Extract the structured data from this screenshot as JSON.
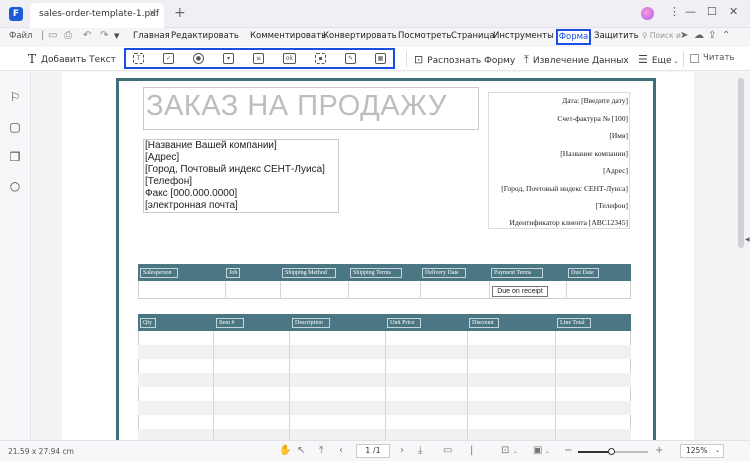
{
  "titlebar": {
    "tab_label": "sales-order-template-1.pdf",
    "close_glyph": "×",
    "new_tab_glyph": "+",
    "win_menu": "⋮",
    "win_minimize": "—",
    "win_maximize": "☐",
    "win_close": "✕"
  },
  "menubar": {
    "file": "Файл",
    "items": [
      "Главная",
      "Редактировать",
      "Комментировать",
      "Конвертировать",
      "Посмотреть",
      "Страница",
      "Инструменты"
    ],
    "active": "Форма",
    "after_active": "Защитить",
    "search_placeholder": "Поиск и"
  },
  "toolbar": {
    "add_text": "Добавить Текст",
    "recognize_form": "Распознать Форму",
    "extract_data": "Извлечение Данных",
    "more": "Еще",
    "read": "Читать",
    "form_tools": [
      "text-field",
      "checkbox",
      "radio-button",
      "combo-box",
      "list-box",
      "button",
      "image-field",
      "signature-field",
      "date-field"
    ]
  },
  "document": {
    "title": "ЗАКАЗ НА ПРОДАЖУ",
    "company_lines": [
      "[Название Вашей компании]",
      "[Адрес]",
      "[Город, Почтовый индекс СЕНТ-Луиса]",
      "[Телефон]",
      "Факс [000.000.0000]",
      "[электронная почта]"
    ],
    "info_lines": [
      "Дата: [Введите дату]",
      "Счет-фактура № [100]",
      "[Имя]",
      "[Название компании]",
      "[Адрес]",
      "[Город, Почтовый индекс СЕНТ-Луиса]",
      "[Телефон]",
      "Идентификатор клиента [ABC12345]"
    ],
    "table1_headers": [
      "Salesperson",
      "Job",
      "Shipping Method",
      "Shipping Terms",
      "Delivery Date",
      "Payment Terms",
      "Due Date"
    ],
    "payment_terms_value": "Due on receipt",
    "table2_headers": [
      "Qty",
      "Item #",
      "Description",
      "Unit Price",
      "Discount",
      "Line Total"
    ]
  },
  "statusbar": {
    "page_size": "21.59 x 27.94 cm",
    "page_indicator": "1 /1",
    "zoom_level": "125%",
    "zoom_fraction": 0.48
  },
  "colors": {
    "accent_blue": "#1a4fe0",
    "table_header": "#4b7683",
    "frame": "#3f6e78"
  }
}
